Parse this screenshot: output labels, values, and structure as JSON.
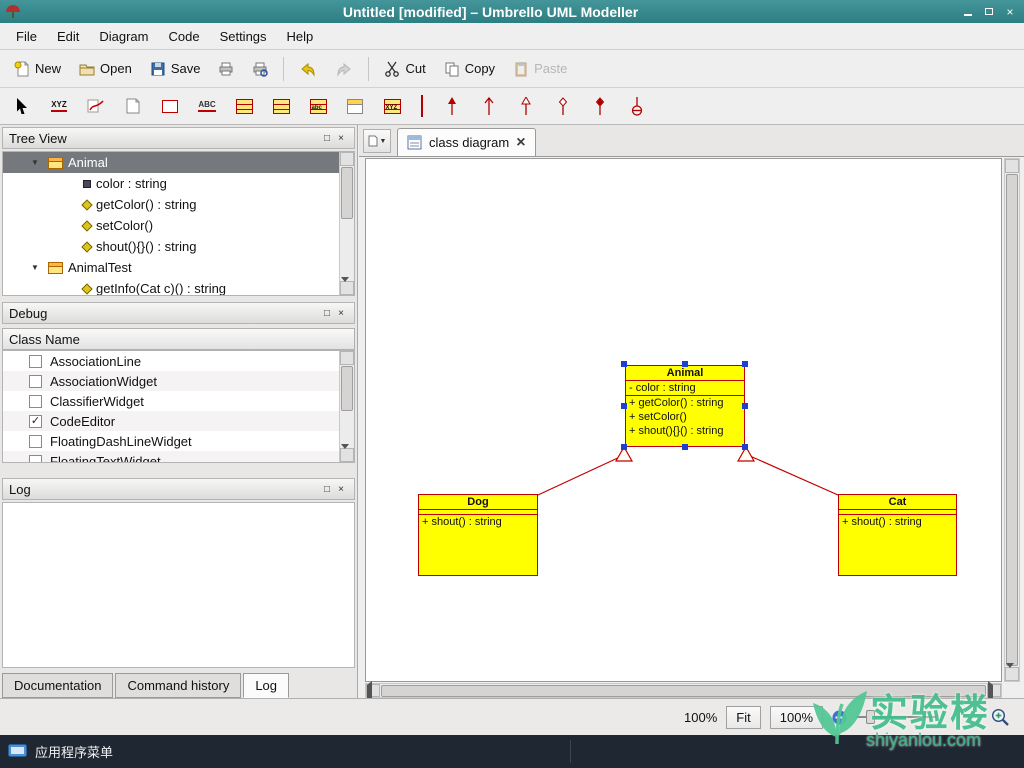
{
  "window": {
    "title": "Untitled [modified] – Umbrello UML Modeller"
  },
  "icons": {
    "close": "×",
    "panel_float": "□",
    "panel_close": "×",
    "expand_arrow": "▼",
    "tab_close": "×",
    "newtab_arrow": "▼"
  },
  "menubar": {
    "items": [
      "File",
      "Edit",
      "Diagram",
      "Code",
      "Settings",
      "Help"
    ]
  },
  "toolbar": {
    "new": "New",
    "open": "Open",
    "save": "Save",
    "cut": "Cut",
    "copy": "Copy",
    "paste": "Paste"
  },
  "uml_toolbar": {
    "text_glyph": "XYZ",
    "label_glyph": "ABC",
    "interface_glyph": "abc",
    "datatype_glyph": "XYZ"
  },
  "tree_view": {
    "title": "Tree View",
    "items": [
      {
        "label": "Animal"
      },
      {
        "label": "color : string"
      },
      {
        "label": "getColor() : string"
      },
      {
        "label": "setColor()"
      },
      {
        "label": "shout(){}() : string"
      },
      {
        "label": "AnimalTest"
      },
      {
        "label": "getInfo(Cat c)() : string"
      }
    ]
  },
  "debug_panel": {
    "title": "Debug",
    "column_header": "Class Name",
    "items": [
      {
        "label": "AssociationLine",
        "check": ""
      },
      {
        "label": "AssociationWidget",
        "check": ""
      },
      {
        "label": "ClassifierWidget",
        "check": ""
      },
      {
        "label": "CodeEditor",
        "check": "✓"
      },
      {
        "label": "FloatingDashLineWidget",
        "check": ""
      },
      {
        "label": "FloatingTextWidget",
        "check": ""
      }
    ]
  },
  "log_panel": {
    "title": "Log"
  },
  "bottom_tabs": {
    "items": [
      "Documentation",
      "Command history",
      "Log"
    ],
    "active": "Log"
  },
  "diagram_tab": {
    "label": "class diagram"
  },
  "uml_classes": {
    "animal": {
      "name": "Animal",
      "attributes": [
        "- color : string"
      ],
      "methods": [
        "+ getColor() : string",
        "+ setColor()",
        "+ shout(){}() : string"
      ]
    },
    "dog": {
      "name": "Dog",
      "methods": [
        "+ shout() : string"
      ]
    },
    "cat": {
      "name": "Cat",
      "methods": [
        "+ shout() : string"
      ]
    }
  },
  "statusbar": {
    "zoom_text": "100%",
    "fit_button": "Fit",
    "zoom_button": "100%"
  },
  "taskbar": {
    "app_menu": "应用程序菜单"
  },
  "watermark": {
    "brand": "实验楼",
    "domain": "shiyanlou.com"
  }
}
